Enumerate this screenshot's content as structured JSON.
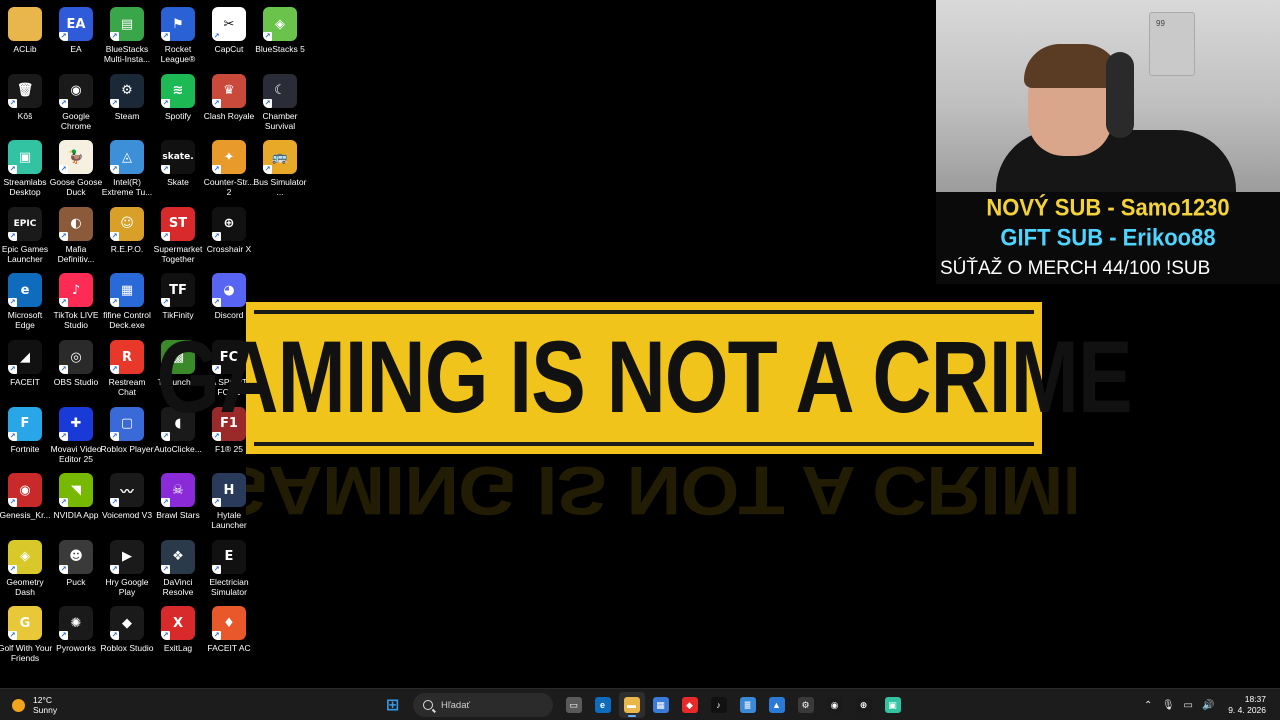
{
  "desktop": {
    "icons": [
      {
        "label": "ACLib",
        "icon": "folder-icon",
        "color": "#e8b64a",
        "glyph": ""
      },
      {
        "label": "EA",
        "icon": "ea-icon",
        "color": "#2f5ad8",
        "glyph": "EA"
      },
      {
        "label": "BlueStacks Multi-Insta...",
        "icon": "bluestacks-multi-icon",
        "color": "#3aa64a",
        "glyph": "▤"
      },
      {
        "label": "Rocket League®",
        "icon": "rocket-league-icon",
        "color": "#2a62d6",
        "glyph": "⚑"
      },
      {
        "label": "CapCut",
        "icon": "capcut-icon",
        "color": "#ffffff",
        "glyph": "✂"
      },
      {
        "label": "BlueStacks 5",
        "icon": "bluestacks-icon",
        "color": "#6ac44c",
        "glyph": "◈"
      },
      {
        "label": "Kôš",
        "icon": "recycle-bin-icon",
        "color": "#1a1a1a",
        "glyph": "🗑"
      },
      {
        "label": "Google Chrome",
        "icon": "chrome-icon",
        "color": "#1a1a1a",
        "glyph": "◉"
      },
      {
        "label": "Steam",
        "icon": "steam-icon",
        "color": "#1b2838",
        "glyph": "⚙"
      },
      {
        "label": "Spotify",
        "icon": "spotify-icon",
        "color": "#1db954",
        "glyph": "≋"
      },
      {
        "label": "Clash Royale",
        "icon": "clash-royale-icon",
        "color": "#c94a3a",
        "glyph": "♛"
      },
      {
        "label": "Chamber Survival",
        "icon": "chamber-survival-icon",
        "color": "#2a2d38",
        "glyph": "☾"
      },
      {
        "label": "Streamlabs Desktop",
        "icon": "streamlabs-icon",
        "color": "#31c3a2",
        "glyph": "▣"
      },
      {
        "label": "Goose Goose Duck",
        "icon": "goose-goose-duck-icon",
        "color": "#f5f0e0",
        "glyph": "🦆"
      },
      {
        "label": "Intel(R) Extreme Tu...",
        "icon": "intel-xtu-icon",
        "color": "#3d8fd8",
        "glyph": "◬"
      },
      {
        "label": "Skate",
        "icon": "skate-icon",
        "color": "#111111",
        "glyph": "skate."
      },
      {
        "label": "Counter-Str... 2",
        "icon": "counter-strike-icon",
        "color": "#e89a2a",
        "glyph": "✦"
      },
      {
        "label": "Bus Simulator ...",
        "icon": "bus-simulator-icon",
        "color": "#e8a828",
        "glyph": "🚌"
      },
      {
        "label": "Epic Games Launcher",
        "icon": "epic-games-icon",
        "color": "#1a1a1a",
        "glyph": "EPIC"
      },
      {
        "label": "Mafia Definitiv...",
        "icon": "mafia-icon",
        "color": "#8a5a3a",
        "glyph": "◐"
      },
      {
        "label": "R.E.P.O.",
        "icon": "repo-icon",
        "color": "#d8a028",
        "glyph": "☺"
      },
      {
        "label": "Supermarket Together",
        "icon": "supermarket-together-icon",
        "color": "#d82a2a",
        "glyph": "ST"
      },
      {
        "label": "Crosshair X",
        "icon": "crosshair-x-icon",
        "color": "#111111",
        "glyph": "⊕"
      },
      {
        "label": "",
        "icon": "",
        "color": "",
        "glyph": ""
      },
      {
        "label": "Microsoft Edge",
        "icon": "edge-icon",
        "color": "#0f6cbd",
        "glyph": "e"
      },
      {
        "label": "TikTok LIVE Studio",
        "icon": "tiktok-live-icon",
        "color": "#fe2c55",
        "glyph": "♪"
      },
      {
        "label": "fifine Control Deck.exe",
        "icon": "fifine-icon",
        "color": "#2a6ad8",
        "glyph": "▦"
      },
      {
        "label": "TikFinity",
        "icon": "tikfinity-icon",
        "color": "#111111",
        "glyph": "TF"
      },
      {
        "label": "Discord",
        "icon": "discord-icon",
        "color": "#5865f2",
        "glyph": "◕"
      },
      {
        "label": "",
        "icon": "",
        "color": "",
        "glyph": ""
      },
      {
        "label": "FACEIT",
        "icon": "faceit-icon",
        "color": "#111111",
        "glyph": "◢"
      },
      {
        "label": "OBS Studio",
        "icon": "obs-icon",
        "color": "#2a2a2a",
        "glyph": "◎"
      },
      {
        "label": "Restream Chat",
        "icon": "restream-icon",
        "color": "#e8382a",
        "glyph": "R"
      },
      {
        "label": "TLauncher",
        "icon": "tlauncher-icon",
        "color": "#3a8a2a",
        "glyph": "▩"
      },
      {
        "label": "EA SPORTS FC 26",
        "icon": "ea-fc26-icon",
        "color": "#111111",
        "glyph": "FC"
      },
      {
        "label": "",
        "icon": "",
        "color": "",
        "glyph": ""
      },
      {
        "label": "Fortnite",
        "icon": "fortnite-icon",
        "color": "#29a6e8",
        "glyph": "F"
      },
      {
        "label": "Movavi Video Editor 25",
        "icon": "movavi-icon",
        "color": "#1a3ad8",
        "glyph": "✚"
      },
      {
        "label": "Roblox Player",
        "icon": "roblox-player-icon",
        "color": "#3a6ad8",
        "glyph": "▢"
      },
      {
        "label": "AutoClicke...",
        "icon": "autoclicker-icon",
        "color": "#1a1a1a",
        "glyph": "◖"
      },
      {
        "label": "F1® 25",
        "icon": "f1-25-icon",
        "color": "#9a2a2a",
        "glyph": "F1"
      },
      {
        "label": "",
        "icon": "",
        "color": "",
        "glyph": ""
      },
      {
        "label": "Genesis_Kr...",
        "icon": "genesis-icon",
        "color": "#c82a2a",
        "glyph": "◉"
      },
      {
        "label": "NVIDIA App",
        "icon": "nvidia-icon",
        "color": "#76b900",
        "glyph": "◥"
      },
      {
        "label": "Voicemod V3",
        "icon": "voicemod-icon",
        "color": "#1a1a1a",
        "glyph": "〰"
      },
      {
        "label": "Brawl Stars",
        "icon": "brawl-stars-icon",
        "color": "#8a2ad8",
        "glyph": "☠"
      },
      {
        "label": "Hytale Launcher",
        "icon": "hytale-icon",
        "color": "#2a3a5a",
        "glyph": "H"
      },
      {
        "label": "",
        "icon": "",
        "color": "",
        "glyph": ""
      },
      {
        "label": "Geometry Dash",
        "icon": "geometry-dash-icon",
        "color": "#d8c82a",
        "glyph": "◈"
      },
      {
        "label": "Puck",
        "icon": "puck-icon",
        "color": "#3a3a3a",
        "glyph": "☻"
      },
      {
        "label": "Hry Google Play",
        "icon": "google-play-games-icon",
        "color": "#1a1a1a",
        "glyph": "▶"
      },
      {
        "label": "DaVinci Resolve",
        "icon": "davinci-icon",
        "color": "#2a3a4a",
        "glyph": "❖"
      },
      {
        "label": "Electrician Simulator",
        "icon": "electrician-simulator-icon",
        "color": "#111111",
        "glyph": "E"
      },
      {
        "label": "",
        "icon": "",
        "color": "",
        "glyph": ""
      },
      {
        "label": "Golf With Your Friends",
        "icon": "golf-icon",
        "color": "#e8c838",
        "glyph": "G"
      },
      {
        "label": "Pyroworks",
        "icon": "pyroworks-icon",
        "color": "#1a1a1a",
        "glyph": "✺"
      },
      {
        "label": "Roblox Studio",
        "icon": "roblox-studio-icon",
        "color": "#1a1a1a",
        "glyph": "◆"
      },
      {
        "label": "ExitLag",
        "icon": "exitlag-icon",
        "color": "#d82a2a",
        "glyph": "X"
      },
      {
        "label": "FACEIT AC",
        "icon": "faceit-ac-icon",
        "color": "#e8582a",
        "glyph": "♦"
      },
      {
        "label": "",
        "icon": "",
        "color": "",
        "glyph": ""
      }
    ]
  },
  "banner": {
    "text": "GAMING IS NOT A CRIME",
    "color": "#f2c31a"
  },
  "overlay": {
    "card_number": "99",
    "new_sub": "NOVÝ SUB - Samo1230",
    "gift_sub": "GIFT SUB - Erikoo88",
    "contest": "SÚŤAŽ O MERCH  44/100 !SUB",
    "new_sub_color": "#f3d23a",
    "gift_sub_color": "#4fd3ff"
  },
  "taskbar": {
    "weather_temp": "12°C",
    "weather_condition": "Sunny",
    "search_placeholder": "Hľadať",
    "apps": [
      {
        "icon": "start-icon",
        "color": "#3a9ae8",
        "glyph": "⊞",
        "active": false
      },
      {
        "icon": "search-icon",
        "color": "",
        "glyph": "",
        "active": false
      },
      {
        "icon": "task-view-icon",
        "color": "#5a5a5a",
        "glyph": "▭",
        "active": false
      },
      {
        "icon": "edge-icon",
        "color": "#0f6cbd",
        "glyph": "e",
        "active": false
      },
      {
        "icon": "file-explorer-icon",
        "color": "#e8b64a",
        "glyph": "▬",
        "active": true
      },
      {
        "icon": "microsoft-store-icon",
        "color": "#3a7ad8",
        "glyph": "▦",
        "active": false
      },
      {
        "icon": "red-diamond-app-icon",
        "color": "#e82a2a",
        "glyph": "◆",
        "active": false
      },
      {
        "icon": "tiktok-icon",
        "color": "#111111",
        "glyph": "♪",
        "active": false
      },
      {
        "icon": "notepad-icon",
        "color": "#3a8ad8",
        "glyph": "≣",
        "active": false
      },
      {
        "icon": "photos-icon",
        "color": "#2a7ad8",
        "glyph": "▲",
        "active": false
      },
      {
        "icon": "settings-icon",
        "color": "#3a3a3a",
        "glyph": "⚙",
        "active": false
      },
      {
        "icon": "chrome-icon",
        "color": "#1a1a1a",
        "glyph": "◉",
        "active": false
      },
      {
        "icon": "crosshair-icon",
        "color": "#1a1a1a",
        "glyph": "⊕",
        "active": false
      },
      {
        "icon": "streamlabs-icon",
        "color": "#31c3a2",
        "glyph": "▣",
        "active": false
      }
    ],
    "tray": [
      {
        "icon": "chevron-up-icon",
        "glyph": "⌃"
      },
      {
        "icon": "microphone-icon",
        "glyph": "🎙"
      },
      {
        "icon": "network-icon",
        "glyph": "▭"
      },
      {
        "icon": "volume-icon",
        "glyph": "🔊"
      }
    ],
    "clock_time": "18:37",
    "clock_date": "9. 4. 2026"
  }
}
